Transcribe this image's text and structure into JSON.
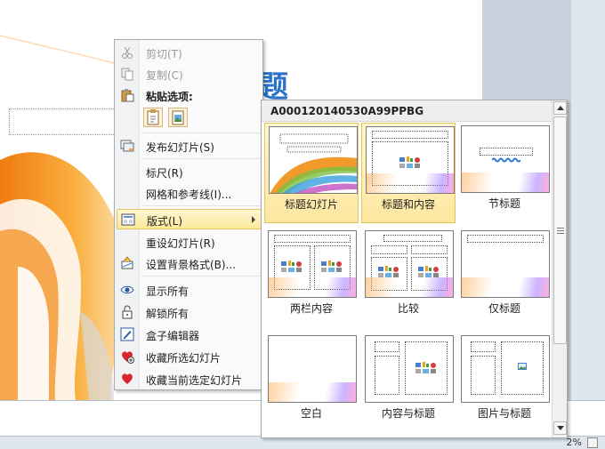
{
  "slide": {
    "title_fragment": "题"
  },
  "status": {
    "zoom": "2%"
  },
  "context_menu": {
    "items": [
      {
        "label": "剪切(T)",
        "icon": "scissors-icon",
        "disabled": true
      },
      {
        "label": "复制(C)",
        "icon": "copy-icon",
        "disabled": true
      },
      {
        "label": "粘贴选项:",
        "icon": "paste-icon",
        "header": true
      },
      {
        "label": "发布幻灯片(S)",
        "icon": "publish-slides-icon"
      },
      {
        "label": "标尺(R)"
      },
      {
        "label": "网格和参考线(I)..."
      },
      {
        "label": "版式(L)",
        "icon": "layout-icon",
        "highlighted": true
      },
      {
        "label": "重设幻灯片(R)"
      },
      {
        "label": "设置背景格式(B)...",
        "icon": "format-background-icon"
      },
      {
        "label": "显示所有",
        "icon": "eye-icon"
      },
      {
        "label": "解锁所有",
        "icon": "lock-icon"
      },
      {
        "label": "盒子编辑器",
        "icon": "edit-icon"
      },
      {
        "label": "收藏所选幻灯片",
        "icon": "heart-add-icon"
      },
      {
        "label": "收藏当前选定幻灯片",
        "icon": "heart-icon"
      }
    ]
  },
  "gallery": {
    "header": "A000120140530A99PPBG",
    "layouts": [
      {
        "label": "标题幻灯片",
        "selected": true
      },
      {
        "label": "标题和内容",
        "selected": true
      },
      {
        "label": "节标题"
      },
      {
        "label": "两栏内容"
      },
      {
        "label": "比较"
      },
      {
        "label": "仅标题"
      },
      {
        "label": "空白"
      },
      {
        "label": "内容与标题"
      },
      {
        "label": "图片与标题"
      }
    ]
  },
  "colors": {
    "highlight": "#fde99a",
    "accent_orange": "#f39a2c",
    "title_blue": "#2a73c9"
  }
}
